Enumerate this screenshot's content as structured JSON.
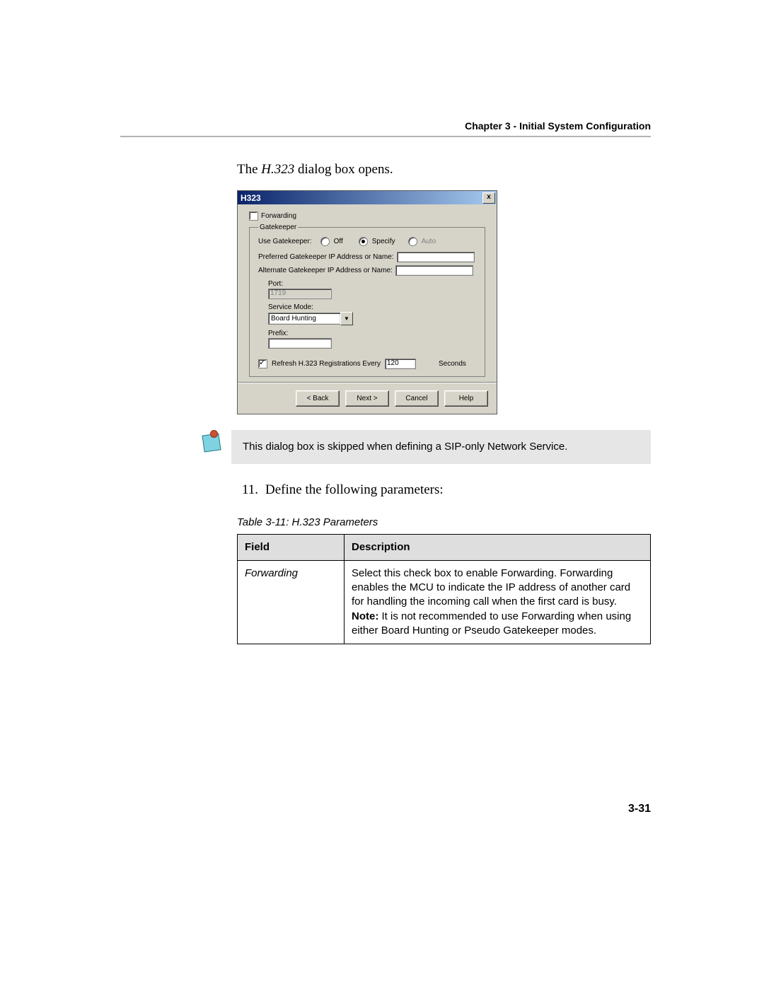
{
  "header": {
    "chapter": "Chapter 3 - Initial System Configuration"
  },
  "intro": {
    "prefix": "The ",
    "ital": "H.323",
    "suffix": " dialog box opens."
  },
  "dialog": {
    "title": "H323",
    "close": "x",
    "forwarding": {
      "label": "Forwarding",
      "checked": false
    },
    "gatekeeper": {
      "legend": "Gatekeeper",
      "use_label": "Use Gatekeeper:",
      "options": {
        "off": {
          "label": "Off",
          "selected": false,
          "disabled": false
        },
        "specify": {
          "label": "Specify",
          "selected": true,
          "disabled": false
        },
        "auto": {
          "label": "Auto",
          "selected": false,
          "disabled": true
        }
      },
      "preferred_label": "Preferred Gatekeeper IP Address or Name:",
      "preferred_value": "",
      "alternate_label": "Alternate Gatekeeper IP Address or Name:",
      "alternate_value": "",
      "port_label": "Port:",
      "port_value": "1719",
      "service_mode_label": "Service Mode:",
      "service_mode_value": "Board Hunting",
      "prefix_label": "Prefix:",
      "prefix_value": "",
      "refresh": {
        "checked": true,
        "label": "Refresh H.323 Registrations Every",
        "value": "120",
        "unit": "Seconds"
      }
    },
    "buttons": {
      "back": "< Back",
      "next": "Next >",
      "cancel": "Cancel",
      "help": "Help"
    }
  },
  "note": {
    "text": "This dialog box is skipped when defining a SIP-only Network Service."
  },
  "step": {
    "number": "11.",
    "text": "Define the following parameters:"
  },
  "table": {
    "caption": "Table 3-11: H.323 Parameters",
    "headers": {
      "field": "Field",
      "description": "Description"
    },
    "rows": [
      {
        "field": "Forwarding",
        "description": "Select this check box to enable Forwarding. Forwarding enables the MCU to indicate the IP address of another card for handling the incoming call when the first card is busy.\nNote: It is not recommended to use Forwarding when using either Board Hunting or Pseudo Gatekeeper modes."
      }
    ]
  },
  "page_number": "3-31"
}
